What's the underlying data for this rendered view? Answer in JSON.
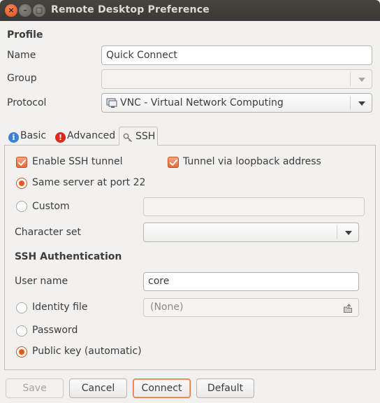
{
  "window": {
    "title": "Remote Desktop Preference"
  },
  "profile": {
    "heading": "Profile",
    "name_label": "Name",
    "name_value": "Quick Connect",
    "group_label": "Group",
    "group_value": "",
    "protocol_label": "Protocol",
    "protocol_value": "VNC - Virtual Network Computing"
  },
  "tabs": [
    {
      "label": "Basic",
      "icon": "info-icon",
      "color": "#3b7fd6"
    },
    {
      "label": "Advanced",
      "icon": "warning-icon",
      "color": "#d92b1e"
    },
    {
      "label": "SSH",
      "icon": "key-icon",
      "active": true
    }
  ],
  "ssh": {
    "enable_tunnel": {
      "label": "Enable SSH tunnel",
      "checked": true
    },
    "loopback": {
      "label": "Tunnel via loopback address",
      "checked": true
    },
    "same_server": {
      "label": "Same server at port 22",
      "selected": true
    },
    "custom": {
      "label": "Custom",
      "selected": false,
      "value": ""
    },
    "charset_label": "Character set",
    "charset_value": "",
    "auth_heading": "SSH Authentication",
    "username_label": "User name",
    "username_value": "core",
    "identity_file": {
      "label": "Identity file",
      "selected": false,
      "value": "(None)"
    },
    "password": {
      "label": "Password",
      "selected": false
    },
    "public_key": {
      "label": "Public key (automatic)",
      "selected": true
    }
  },
  "buttons": {
    "save": "Save",
    "cancel": "Cancel",
    "connect": "Connect",
    "default": "Default"
  },
  "colors": {
    "accent": "#e8591f",
    "titlebar": "#3c3b37",
    "window_bg": "#f2f1f0"
  }
}
